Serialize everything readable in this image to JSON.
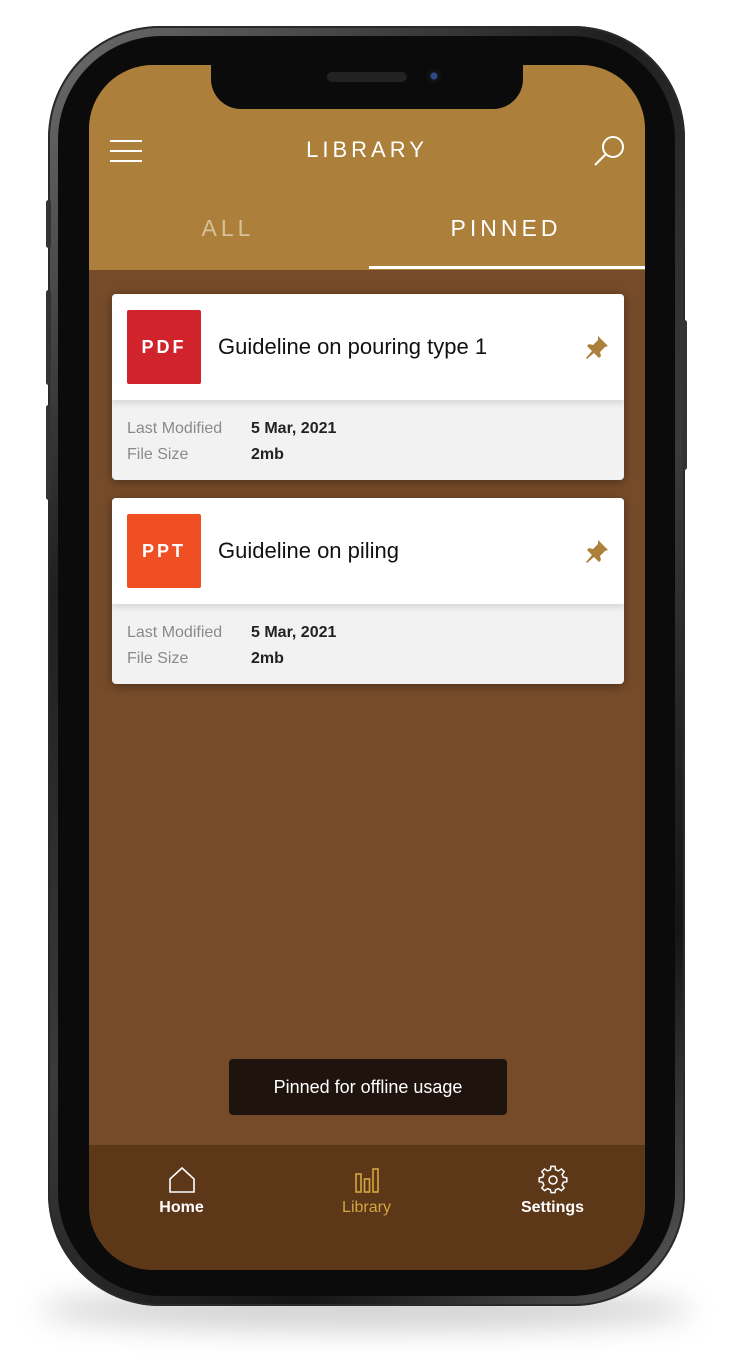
{
  "app": {
    "title": "LIBRARY",
    "accent_color": "#ac803a",
    "background_color": "#764b29"
  },
  "tabs": [
    {
      "label": "ALL",
      "active": false
    },
    {
      "label": "PINNED",
      "active": true
    }
  ],
  "files": [
    {
      "type_badge": "PDF",
      "badge_color": "#d0232c",
      "title": "Guideline on pouring type 1",
      "pinned": true,
      "last_modified_label": "Last Modified",
      "last_modified_value": "5 Mar, 2021",
      "file_size_label": "File Size",
      "file_size_value": "2mb"
    },
    {
      "type_badge": "PPT",
      "badge_color": "#f04f23",
      "title": "Guideline on piling",
      "pinned": true,
      "last_modified_label": "Last Modified",
      "last_modified_value": "5 Mar, 2021",
      "file_size_label": "File Size",
      "file_size_value": "2mb"
    }
  ],
  "toast": {
    "message": "Pinned for offline usage"
  },
  "bottom_nav": [
    {
      "label": "Home",
      "icon": "home-icon",
      "active": false
    },
    {
      "label": "Library",
      "icon": "library-icon",
      "active": true
    },
    {
      "label": "Settings",
      "icon": "settings-icon",
      "active": false
    }
  ]
}
